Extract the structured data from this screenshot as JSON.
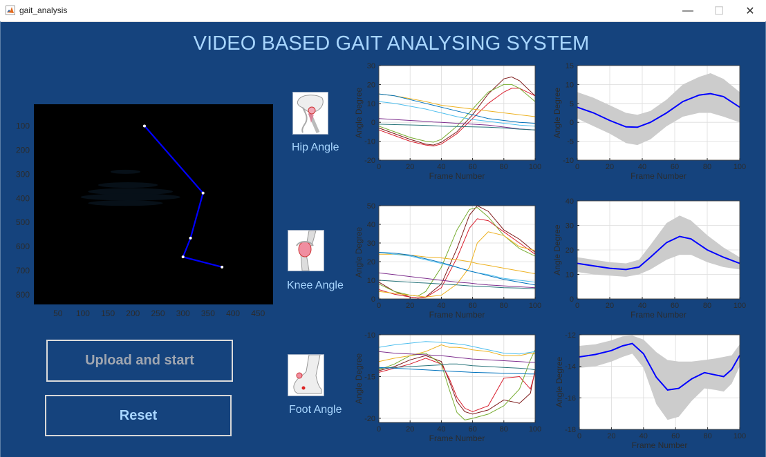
{
  "window": {
    "title": "gait_analysis",
    "minimize": "—",
    "maximize": "☐",
    "close": "✕"
  },
  "app": {
    "title": "VIDEO BASED GAIT ANALYSING SYSTEM"
  },
  "colors": {
    "background": "#15437d",
    "title_text": "#a8d6ff",
    "axes_text": "#2b2b2b",
    "mean_line": "#0000ff",
    "band": "#cccccc"
  },
  "joints": [
    {
      "icon": "hip-joint-icon",
      "label": "Hip Angle"
    },
    {
      "icon": "knee-joint-icon",
      "label": "Knee Angle"
    },
    {
      "icon": "foot-joint-icon",
      "label": "Foot Angle"
    }
  ],
  "buttons": {
    "upload": "Upload and start",
    "reset": "Reset"
  },
  "chart_data": [
    {
      "id": "skeleton",
      "type": "scatter",
      "xticks": [
        50,
        100,
        150,
        200,
        250,
        300,
        350,
        400,
        450
      ],
      "yticks": [
        100,
        200,
        300,
        400,
        500,
        600,
        700,
        800
      ],
      "xlim": [
        2,
        480
      ],
      "ylim": [
        840,
        10
      ],
      "points": [
        [
          223,
          100
        ],
        [
          340,
          378
        ],
        [
          315,
          565
        ],
        [
          300,
          643
        ],
        [
          378,
          685
        ]
      ],
      "line_color": "#0000ff",
      "grid": false
    },
    {
      "id": "hip-raw",
      "type": "line",
      "xlabel": "Frame Number",
      "ylabel": "Angle Degree",
      "xlim": [
        0,
        100
      ],
      "ylim": [
        -20,
        30
      ],
      "xticks": [
        0,
        20,
        40,
        60,
        80,
        100
      ],
      "yticks": [
        -20,
        -10,
        0,
        10,
        20,
        30
      ],
      "x": [
        0,
        10,
        20,
        30,
        35,
        40,
        50,
        60,
        70,
        80,
        85,
        90,
        100
      ],
      "series": [
        {
          "color": "#7e1b1b",
          "values": [
            -3,
            -6,
            -9,
            -11.5,
            -12,
            -10.5,
            -5,
            4,
            15,
            23,
            24,
            22,
            14
          ]
        },
        {
          "color": "#d9202f",
          "values": [
            -4,
            -7,
            -10,
            -12,
            -12.5,
            -11.5,
            -6,
            2,
            10,
            16,
            18,
            18,
            14
          ]
        },
        {
          "color": "#77ac30",
          "values": [
            -2,
            -5,
            -8,
            -10,
            -10.5,
            -9,
            -2,
            7,
            16,
            20,
            20,
            18,
            11
          ]
        },
        {
          "color": "#edb120",
          "values": [
            15,
            14,
            12.5,
            11,
            10,
            9,
            8,
            7,
            6,
            5,
            4.5,
            4,
            3
          ]
        },
        {
          "color": "#4dbeee",
          "values": [
            11,
            10,
            8.5,
            7,
            6,
            5,
            3,
            1.5,
            0.5,
            -0.5,
            -1,
            -1.5,
            -2
          ]
        },
        {
          "color": "#0072bd",
          "values": [
            15,
            14,
            12,
            10,
            9,
            8,
            6,
            4,
            2,
            1,
            0.5,
            0,
            -0.5
          ]
        },
        {
          "color": "#7e2f8e",
          "values": [
            2,
            1.5,
            1,
            0.5,
            0.2,
            0,
            -0.5,
            -1,
            -1.5,
            -2.5,
            -3,
            -3.5,
            -4
          ]
        },
        {
          "color": "#27747a",
          "values": [
            -1,
            -1.2,
            -1.4,
            -1.6,
            -1.8,
            -2,
            -2.2,
            -2.4,
            -2.6,
            -3,
            -3.3,
            -3.6,
            -4
          ]
        }
      ]
    },
    {
      "id": "hip-mean",
      "type": "area",
      "xlabel": "Frame Number",
      "ylabel": "Angle Degree",
      "xlim": [
        0,
        100
      ],
      "ylim": [
        -10,
        15
      ],
      "xticks": [
        0,
        20,
        40,
        60,
        80,
        100
      ],
      "yticks": [
        -10,
        -5,
        0,
        5,
        10,
        15
      ],
      "x": [
        0,
        10,
        20,
        30,
        37,
        45,
        55,
        65,
        75,
        82,
        90,
        100
      ],
      "mean": [
        4,
        2.5,
        0.5,
        -1.2,
        -1.3,
        0,
        2.5,
        5.5,
        7.2,
        7.6,
        6.8,
        4
      ],
      "upper": [
        8,
        6.5,
        4.5,
        2.5,
        2,
        3,
        6,
        10,
        12,
        13,
        11.5,
        8
      ],
      "lower": [
        1,
        -1,
        -3,
        -5.5,
        -6,
        -4.5,
        -1,
        1.5,
        2.5,
        2.5,
        1.5,
        0
      ]
    },
    {
      "id": "knee-raw",
      "type": "line",
      "xlabel": "Frame Number",
      "ylabel": "Angle Degree",
      "xlim": [
        0,
        100
      ],
      "ylim": [
        0,
        50
      ],
      "xticks": [
        0,
        20,
        40,
        60,
        80,
        100
      ],
      "yticks": [
        0,
        10,
        20,
        30,
        40,
        50
      ],
      "x": [
        0,
        10,
        20,
        25,
        30,
        40,
        50,
        58,
        63,
        70,
        80,
        90,
        100
      ],
      "series": [
        {
          "color": "#7e1b1b",
          "values": [
            9,
            4,
            1,
            0.5,
            1,
            8,
            27,
            45,
            50,
            47,
            37,
            32,
            25
          ]
        },
        {
          "color": "#d9202f",
          "values": [
            5,
            2.5,
            1,
            0.5,
            0.8,
            6,
            22,
            38,
            43,
            42,
            36,
            30,
            24
          ]
        },
        {
          "color": "#77ac30",
          "values": [
            8,
            4,
            2,
            1.5,
            4,
            17,
            37,
            48,
            49,
            44,
            34,
            27,
            23
          ]
        },
        {
          "color": "#edb120",
          "values": [
            4,
            3,
            2,
            1.5,
            1,
            2,
            8,
            17,
            30,
            36,
            34,
            28,
            26
          ]
        },
        {
          "color": "#edb120",
          "values": [
            24,
            24,
            23.5,
            23,
            22.5,
            22,
            21,
            20,
            19,
            18,
            16.5,
            15,
            13.5
          ]
        },
        {
          "color": "#4dbeee",
          "values": [
            25,
            24,
            23,
            22,
            21,
            19,
            17,
            15,
            14,
            13,
            11,
            10,
            9
          ]
        },
        {
          "color": "#0072bd",
          "values": [
            25,
            24.5,
            23.5,
            22.5,
            21.5,
            19.5,
            17,
            15,
            14,
            12.5,
            10.5,
            9,
            7.5
          ]
        },
        {
          "color": "#7e2f8e",
          "values": [
            14,
            13,
            12,
            11.5,
            11,
            10,
            9,
            8.5,
            8,
            7.5,
            7,
            6.5,
            6
          ]
        },
        {
          "color": "#27747a",
          "values": [
            10,
            9.5,
            9,
            8.7,
            8.5,
            8,
            7.5,
            7,
            6.8,
            6.5,
            6,
            5.8,
            5.5
          ]
        }
      ]
    },
    {
      "id": "knee-mean",
      "type": "area",
      "xlabel": "Frame Number",
      "ylabel": "Angle Degree",
      "xlim": [
        0,
        100
      ],
      "ylim": [
        0,
        40
      ],
      "xticks": [
        0,
        20,
        40,
        60,
        80,
        100
      ],
      "yticks": [
        0,
        10,
        20,
        30,
        40
      ],
      "x": [
        0,
        10,
        20,
        30,
        38,
        45,
        55,
        63,
        70,
        80,
        90,
        100
      ],
      "mean": [
        14.5,
        13.5,
        12.5,
        12,
        13,
        17,
        23,
        25.5,
        24.5,
        20,
        17,
        14.5
      ],
      "upper": [
        17,
        16,
        15,
        14.5,
        16,
        22,
        31,
        34,
        32,
        26,
        21,
        17
      ],
      "lower": [
        11,
        10,
        9.5,
        9,
        10,
        12,
        16,
        18,
        18,
        15,
        13,
        12
      ]
    },
    {
      "id": "foot-raw",
      "type": "line",
      "xlabel": "Frame Number",
      "ylabel": "Angle Degree",
      "xlim": [
        0,
        100
      ],
      "ylim": [
        -20.5,
        -10
      ],
      "xticks": [
        0,
        20,
        40,
        60,
        80,
        100
      ],
      "yticks": [
        -20,
        -15,
        -10
      ],
      "x": [
        0,
        10,
        20,
        30,
        40,
        45,
        50,
        55,
        60,
        70,
        80,
        90,
        97,
        100
      ],
      "series": [
        {
          "color": "#7e1b1b",
          "values": [
            -14.3,
            -13.8,
            -13,
            -12.5,
            -13.2,
            -15.5,
            -18,
            -19.2,
            -19.5,
            -19,
            -17.8,
            -18.2,
            -17,
            -14.2
          ]
        },
        {
          "color": "#d9202f",
          "values": [
            -14.5,
            -14,
            -13.5,
            -12.8,
            -13.5,
            -15.2,
            -17.5,
            -18.8,
            -19.2,
            -18.5,
            -15.2,
            -15,
            -16.5,
            -14.5
          ]
        },
        {
          "color": "#77ac30",
          "values": [
            -14.2,
            -13.5,
            -12.5,
            -12.2,
            -13.5,
            -16.5,
            -19.3,
            -20.2,
            -20,
            -19.5,
            -18.5,
            -16.5,
            -13,
            -11.8
          ]
        },
        {
          "color": "#edb120",
          "values": [
            -13.2,
            -12.8,
            -12.5,
            -12,
            -11.2,
            -11.5,
            -11.5,
            -11.6,
            -11.8,
            -12,
            -12.5,
            -12.5,
            -12.2,
            -12.3
          ]
        },
        {
          "color": "#4dbeee",
          "values": [
            -11.5,
            -11.2,
            -11,
            -10.8,
            -10.9,
            -11,
            -11.1,
            -11.2,
            -11.4,
            -11.8,
            -12.2,
            -12.3,
            -12.1,
            -12
          ]
        },
        {
          "color": "#7e2f8e",
          "values": [
            -12,
            -12.2,
            -12.3,
            -12.4,
            -12.5,
            -12.6,
            -12.7,
            -12.8,
            -12.9,
            -13,
            -13.1,
            -13.2,
            -13.3,
            -13.3
          ]
        },
        {
          "color": "#27747a",
          "values": [
            -14,
            -13.9,
            -13.8,
            -13.7,
            -13.6,
            -13.5,
            -13.5,
            -13.6,
            -13.7,
            -13.8,
            -13.9,
            -14,
            -14.1,
            -14.2
          ]
        },
        {
          "color": "#0072bd",
          "values": [
            -13.9,
            -14,
            -14.1,
            -14.2,
            -14.3,
            -14.35,
            -14.4,
            -14.45,
            -14.5,
            -14.55,
            -14.6,
            -14.65,
            -14.7,
            -14.7
          ]
        }
      ]
    },
    {
      "id": "foot-mean",
      "type": "area",
      "xlabel": "Frame Number",
      "ylabel": "Angle Degree",
      "xlim": [
        0,
        100
      ],
      "ylim": [
        -18,
        -12
      ],
      "xticks": [
        0,
        20,
        40,
        60,
        80,
        100
      ],
      "yticks": [
        -18,
        -16,
        -14,
        -12
      ],
      "x": [
        0,
        10,
        20,
        27,
        33,
        40,
        48,
        55,
        62,
        70,
        78,
        85,
        90,
        95,
        100
      ],
      "mean": [
        -13.4,
        -13.25,
        -13,
        -12.7,
        -12.55,
        -13.2,
        -14.7,
        -15.5,
        -15.4,
        -14.8,
        -14.4,
        -14.55,
        -14.65,
        -14.2,
        -13.3
      ],
      "upper": [
        -12.7,
        -12.6,
        -12.35,
        -12.1,
        -12.05,
        -12.3,
        -13.1,
        -13.6,
        -13.7,
        -13.7,
        -13.6,
        -13.5,
        -13.4,
        -13.3,
        -12.6
      ],
      "lower": [
        -14.1,
        -14,
        -13.7,
        -13.4,
        -13.2,
        -14.1,
        -16.4,
        -17.4,
        -17.2,
        -16.2,
        -15.4,
        -15.5,
        -15.6,
        -15.1,
        -14.0
      ]
    }
  ]
}
